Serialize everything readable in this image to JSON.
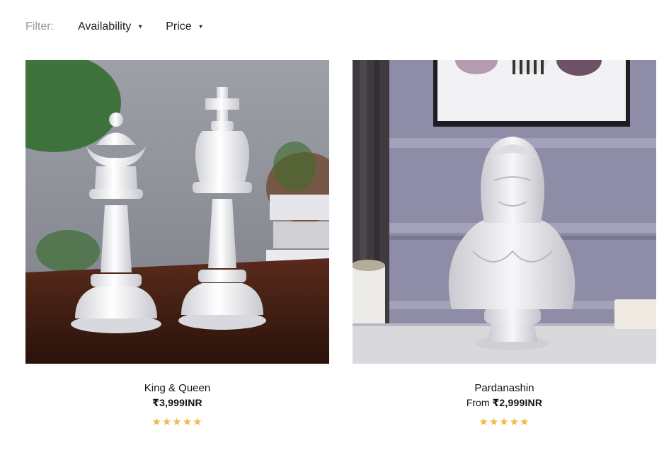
{
  "filter": {
    "label": "Filter:",
    "availability_label": "Availability",
    "price_label": "Price",
    "caret_icon": "caret-down-icon"
  },
  "colors": {
    "star": "#f0b94a",
    "filter_label": "#9a9a9a"
  },
  "products": [
    {
      "title": "King & Queen",
      "price_prefix": "",
      "price": "₹3,999INR",
      "stars": "★★★★★",
      "rating": 5,
      "image": "white chess king and queen sculptures"
    },
    {
      "title": "Pardanashin",
      "price_prefix": "From",
      "price": "₹2,999INR",
      "stars": "★★★★★",
      "rating": 4.5,
      "image": "white veiled lady bust sculpture"
    }
  ]
}
